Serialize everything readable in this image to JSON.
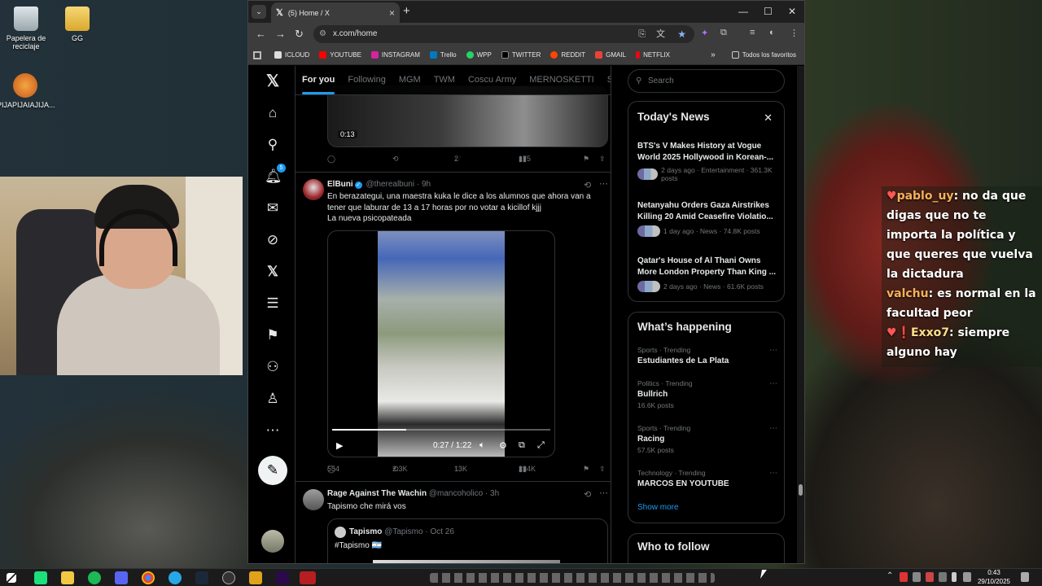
{
  "desktop": {
    "icons": [
      {
        "label": "Papelera de reciclaje"
      },
      {
        "label": "GG"
      },
      {
        "label": "PIJAPIJAIAJIJA..."
      }
    ]
  },
  "chat": {
    "messages": [
      {
        "user": "pablo_uy",
        "sep": ":",
        "text": "no da que digas que no te importa la política y que queres que vuelva la dictadura"
      },
      {
        "user": "valchu",
        "sep": ":",
        "text": "es normal en la facultad peor"
      },
      {
        "user": "Exxo7",
        "sep": ":",
        "text": "siempre alguno hay"
      }
    ]
  },
  "browser": {
    "tab_title": "(5) Home / X",
    "url": "x.com/home",
    "bookmarks": [
      "ICLOUD",
      "YOUTUBE",
      "INSTAGRAM",
      "Trello",
      "WPP",
      "TWITTER",
      "REDDIT",
      "GMAIL",
      "NETFLIX"
    ],
    "all_favorites": "Todos los favoritos",
    "colors": {
      "accent": "#1d9bf0",
      "bg": "#000000"
    }
  },
  "x": {
    "notification_count": "5",
    "feed_tabs": [
      "For you",
      "Following",
      "MGM",
      "TWM",
      "Coscu Army",
      "MERNOSKETTI",
      "S"
    ],
    "post1": {
      "video_time": "0:13",
      "replies": "",
      "reposts": "",
      "likes": "2",
      "views": "175"
    },
    "post2": {
      "name": "ElBuni",
      "handle": "@therealbuni",
      "time": "9h",
      "text_line1": "En berazategui, una maestra kuka le dice a los alumnos que ahora van a",
      "text_line2": "tener que laburar de 13 a 17 horas por no votar a kicillof kjjj",
      "text_line3": "La nueva psicopateada",
      "video_time": "0:27 / 1:22",
      "video_progress": 0.34,
      "replies": "554",
      "reposts": "2.3K",
      "likes": "13K",
      "views": "234K"
    },
    "post3": {
      "name": "Rage Against The Wachin",
      "handle": "@mancoholico",
      "time": "3h",
      "text": "Tapismo che mirá vos",
      "quote_name": "Tapismo",
      "quote_handle": "@Tapismo",
      "quote_time": "Oct 26",
      "quote_text": "#Tapismo 🇦🇷"
    },
    "search_placeholder": "Search",
    "news_title": "Today's News",
    "news": [
      {
        "title": "BTS's V Makes History at Vogue World 2025 Hollywood in Korean-...",
        "meta": "2 days ago · Entertainment · 361.3K posts"
      },
      {
        "title": "Netanyahu Orders Gaza Airstrikes Killing 20 Amid Ceasefire Violatio...",
        "meta": "1 day ago · News · 74.8K posts"
      },
      {
        "title": "Qatar's House of Al Thani Owns More London Property Than King ...",
        "meta": "2 days ago · News · 61.6K posts"
      }
    ],
    "happening_title": "What’s happening",
    "trends": [
      {
        "cat": "Sports · Trending",
        "name": "Estudiantes de La Plata",
        "posts": ""
      },
      {
        "cat": "Politics · Trending",
        "name": "Bullrich",
        "posts": "16.6K posts"
      },
      {
        "cat": "Sports · Trending",
        "name": "Racing",
        "posts": "57.5K posts"
      },
      {
        "cat": "Technology · Trending",
        "name": "MARCOS EN YOUTUBE",
        "posts": ""
      }
    ],
    "show_more": "Show more",
    "who_to_follow": "Who to follow"
  },
  "taskbar": {
    "time": "0:43",
    "date": "29/10/2025"
  }
}
